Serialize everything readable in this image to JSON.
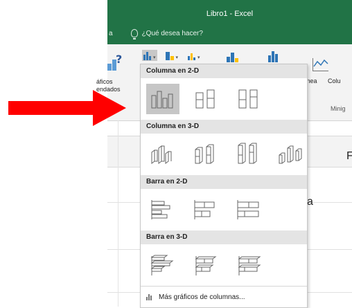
{
  "window": {
    "title": "Libro1 - Excel",
    "tab_fragment": "a",
    "tell_me": "¿Qué desea hacer?"
  },
  "ribbon": {
    "recommended_label_line1": "áficos",
    "recommended_label_line2": "endados",
    "line_label": "Línea",
    "column_label_partial": "Colu",
    "sparklines_group_partial": "Minig",
    "colors": {
      "excel_green": "#217346",
      "column_blue": "#2e75b6",
      "accent_orange": "#ffc000"
    }
  },
  "dropdown": {
    "sections": [
      {
        "title": "Columna en 2-D",
        "options": [
          "clustered-column-icon",
          "stacked-column-icon",
          "100-stacked-column-icon"
        ],
        "selected_index": 0
      },
      {
        "title": "Columna en 3-D",
        "options": [
          "3d-clustered-column-icon",
          "3d-stacked-column-icon",
          "3d-100-stacked-column-icon",
          "3d-column-icon"
        ]
      },
      {
        "title": "Barra en 2-D",
        "options": [
          "clustered-bar-icon",
          "stacked-bar-icon",
          "100-stacked-bar-icon"
        ]
      },
      {
        "title": "Barra en 3-D",
        "options": [
          "3d-clustered-bar-icon",
          "3d-stacked-bar-icon",
          "3d-100-stacked-bar-icon"
        ]
      }
    ],
    "more_link": "Más gráficos de columnas..."
  },
  "sheet": {
    "header_letter": "F",
    "cell_text": "a"
  },
  "annotation": {
    "arrow_color": "#ff0000"
  }
}
